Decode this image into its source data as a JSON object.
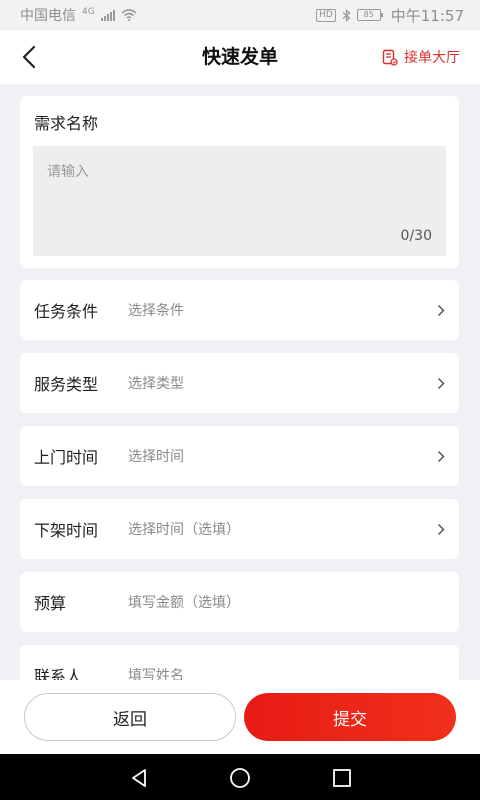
{
  "status_bar": {
    "carrier": "中国电信",
    "network": "4G",
    "hd": "HD",
    "battery": "85",
    "time": "中午11:57"
  },
  "nav": {
    "title": "快速发单",
    "hall_link": "接单大厅"
  },
  "name_section": {
    "title": "需求名称",
    "placeholder": "请输入",
    "counter": "0/30"
  },
  "rows": [
    {
      "label": "任务条件",
      "value": "选择条件",
      "has_arrow": true
    },
    {
      "label": "服务类型",
      "value": "选择类型",
      "has_arrow": true
    },
    {
      "label": "上门时间",
      "value": "选择时间",
      "has_arrow": true
    },
    {
      "label": "下架时间",
      "value": "选择时间（选填）",
      "has_arrow": true
    },
    {
      "label": "预算",
      "value": "填写金额（选填）",
      "has_arrow": false
    },
    {
      "label": "联系人",
      "value": "填写姓名",
      "has_arrow": false
    }
  ],
  "buttons": {
    "back": "返回",
    "submit": "提交"
  },
  "colors": {
    "accent": "#e81b16",
    "background": "#f1f1f5"
  },
  "icons": {
    "back": "chevron-left-icon",
    "hall": "document-icon",
    "row_arrow": "chevron-right-icon",
    "sys_back": "triangle-back-icon",
    "sys_home": "circle-home-icon",
    "sys_recent": "square-recent-icon"
  }
}
